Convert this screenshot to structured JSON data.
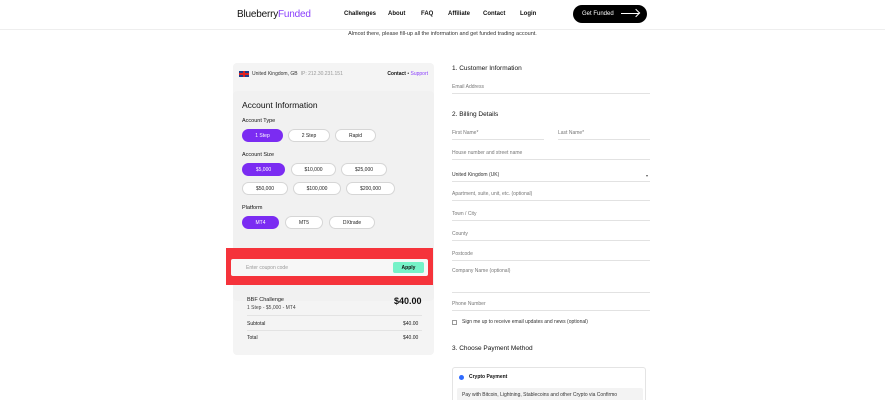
{
  "header": {
    "logo_part1": "Blueberry",
    "logo_part2": "Funded",
    "nav": [
      "Challenges",
      "About",
      "FAQ",
      "Affiliate",
      "Contact",
      "Login"
    ],
    "cta_label": "Get Funded"
  },
  "intro": "Almost there, please fill-up all the information and get funded trading account.",
  "location": {
    "country_label": "United Kingdom, GB",
    "ip_label": "IP: 212.30.231.151",
    "contact_label": "Contact",
    "separator": "•",
    "support_label": "Support"
  },
  "account": {
    "title": "Account Information",
    "type_label": "Account Type",
    "types": [
      "1 Step",
      "2 Step",
      "Rapid"
    ],
    "size_label": "Account Size",
    "sizes": [
      "$5,000",
      "$10,000",
      "$25,000",
      "$50,000",
      "$100,000",
      "$200,000"
    ],
    "platform_label": "Platform",
    "platforms": [
      "MT4",
      "MT5",
      "DXtrade"
    ]
  },
  "coupon": {
    "placeholder": "Enter coupon code",
    "apply_label": "Apply"
  },
  "summary": {
    "product": "BBF Challenge",
    "details": "1 Step  -  $5,000  -  MT4",
    "price": "$40.00",
    "subtotal_label": "Subtotal",
    "subtotal_value": "$40.00",
    "total_label": "Total",
    "total_value": "$40.00"
  },
  "customer": {
    "heading": "1. Customer Information",
    "email_placeholder": "Email Address"
  },
  "billing": {
    "heading": "2. Billing Details",
    "first_name": "First Name*",
    "last_name": "Last Name*",
    "street": "House number and street name",
    "country": "United Kingdom (UK)",
    "apartment": "Apartment, suite, unit, etc. (optional)",
    "city": "Town / City",
    "county": "County",
    "postcode": "Postcode",
    "company": "Company Name (optional)",
    "phone": "Phone Number",
    "signup": "Sign me up to receive email updates and news (optional)"
  },
  "payment": {
    "heading": "3. Choose Payment Method",
    "method": "Crypto Payment",
    "description": "Pay with Bitcoin, Lightning, Stablecoins and other Crypto via Confirmo"
  }
}
